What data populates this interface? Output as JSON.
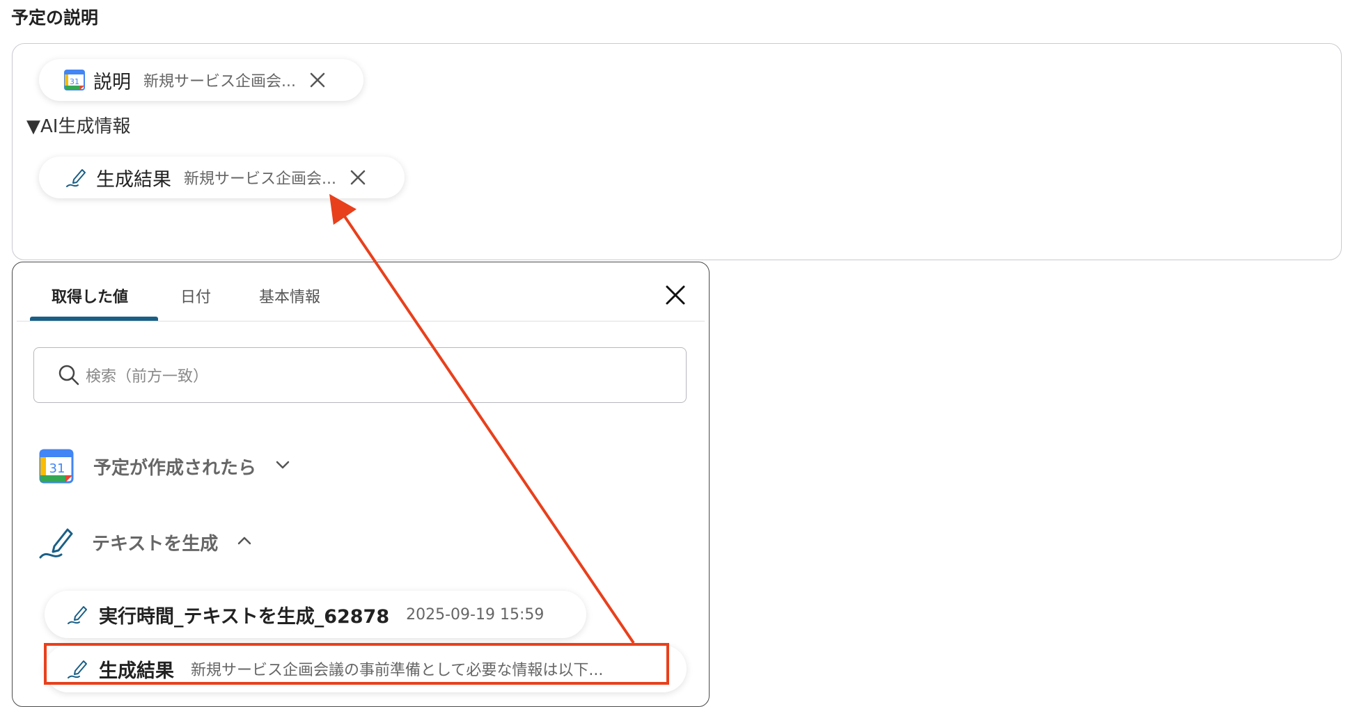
{
  "section_title": "予定の説明",
  "desc_box": {
    "chip1": {
      "label": "説明",
      "value": "新規サービス企画会..."
    },
    "section_text": "▼AI生成情報",
    "chip2": {
      "label": "生成結果",
      "value": "新規サービス企画会..."
    }
  },
  "panel": {
    "tabs": [
      {
        "label": "取得した値",
        "active": true
      },
      {
        "label": "日付",
        "active": false
      },
      {
        "label": "基本情報",
        "active": false
      }
    ],
    "search_placeholder": "検索（前方一致）",
    "groups": [
      {
        "title": "予定が作成されたら",
        "expanded": false,
        "icon": "google-calendar-icon"
      },
      {
        "title": "テキストを生成",
        "expanded": true,
        "icon": "ai-pen-icon"
      }
    ],
    "items": [
      {
        "label": "実行時間_テキストを生成_62878",
        "value": "2025-09-19 15:59"
      },
      {
        "label": "生成結果",
        "value": "新規サービス企画会議の事前準備として必要な情報は以下..."
      }
    ]
  },
  "calendar_icon_text": "31",
  "colors": {
    "accent": "#1a5f86",
    "annotation": "#e8401c"
  }
}
